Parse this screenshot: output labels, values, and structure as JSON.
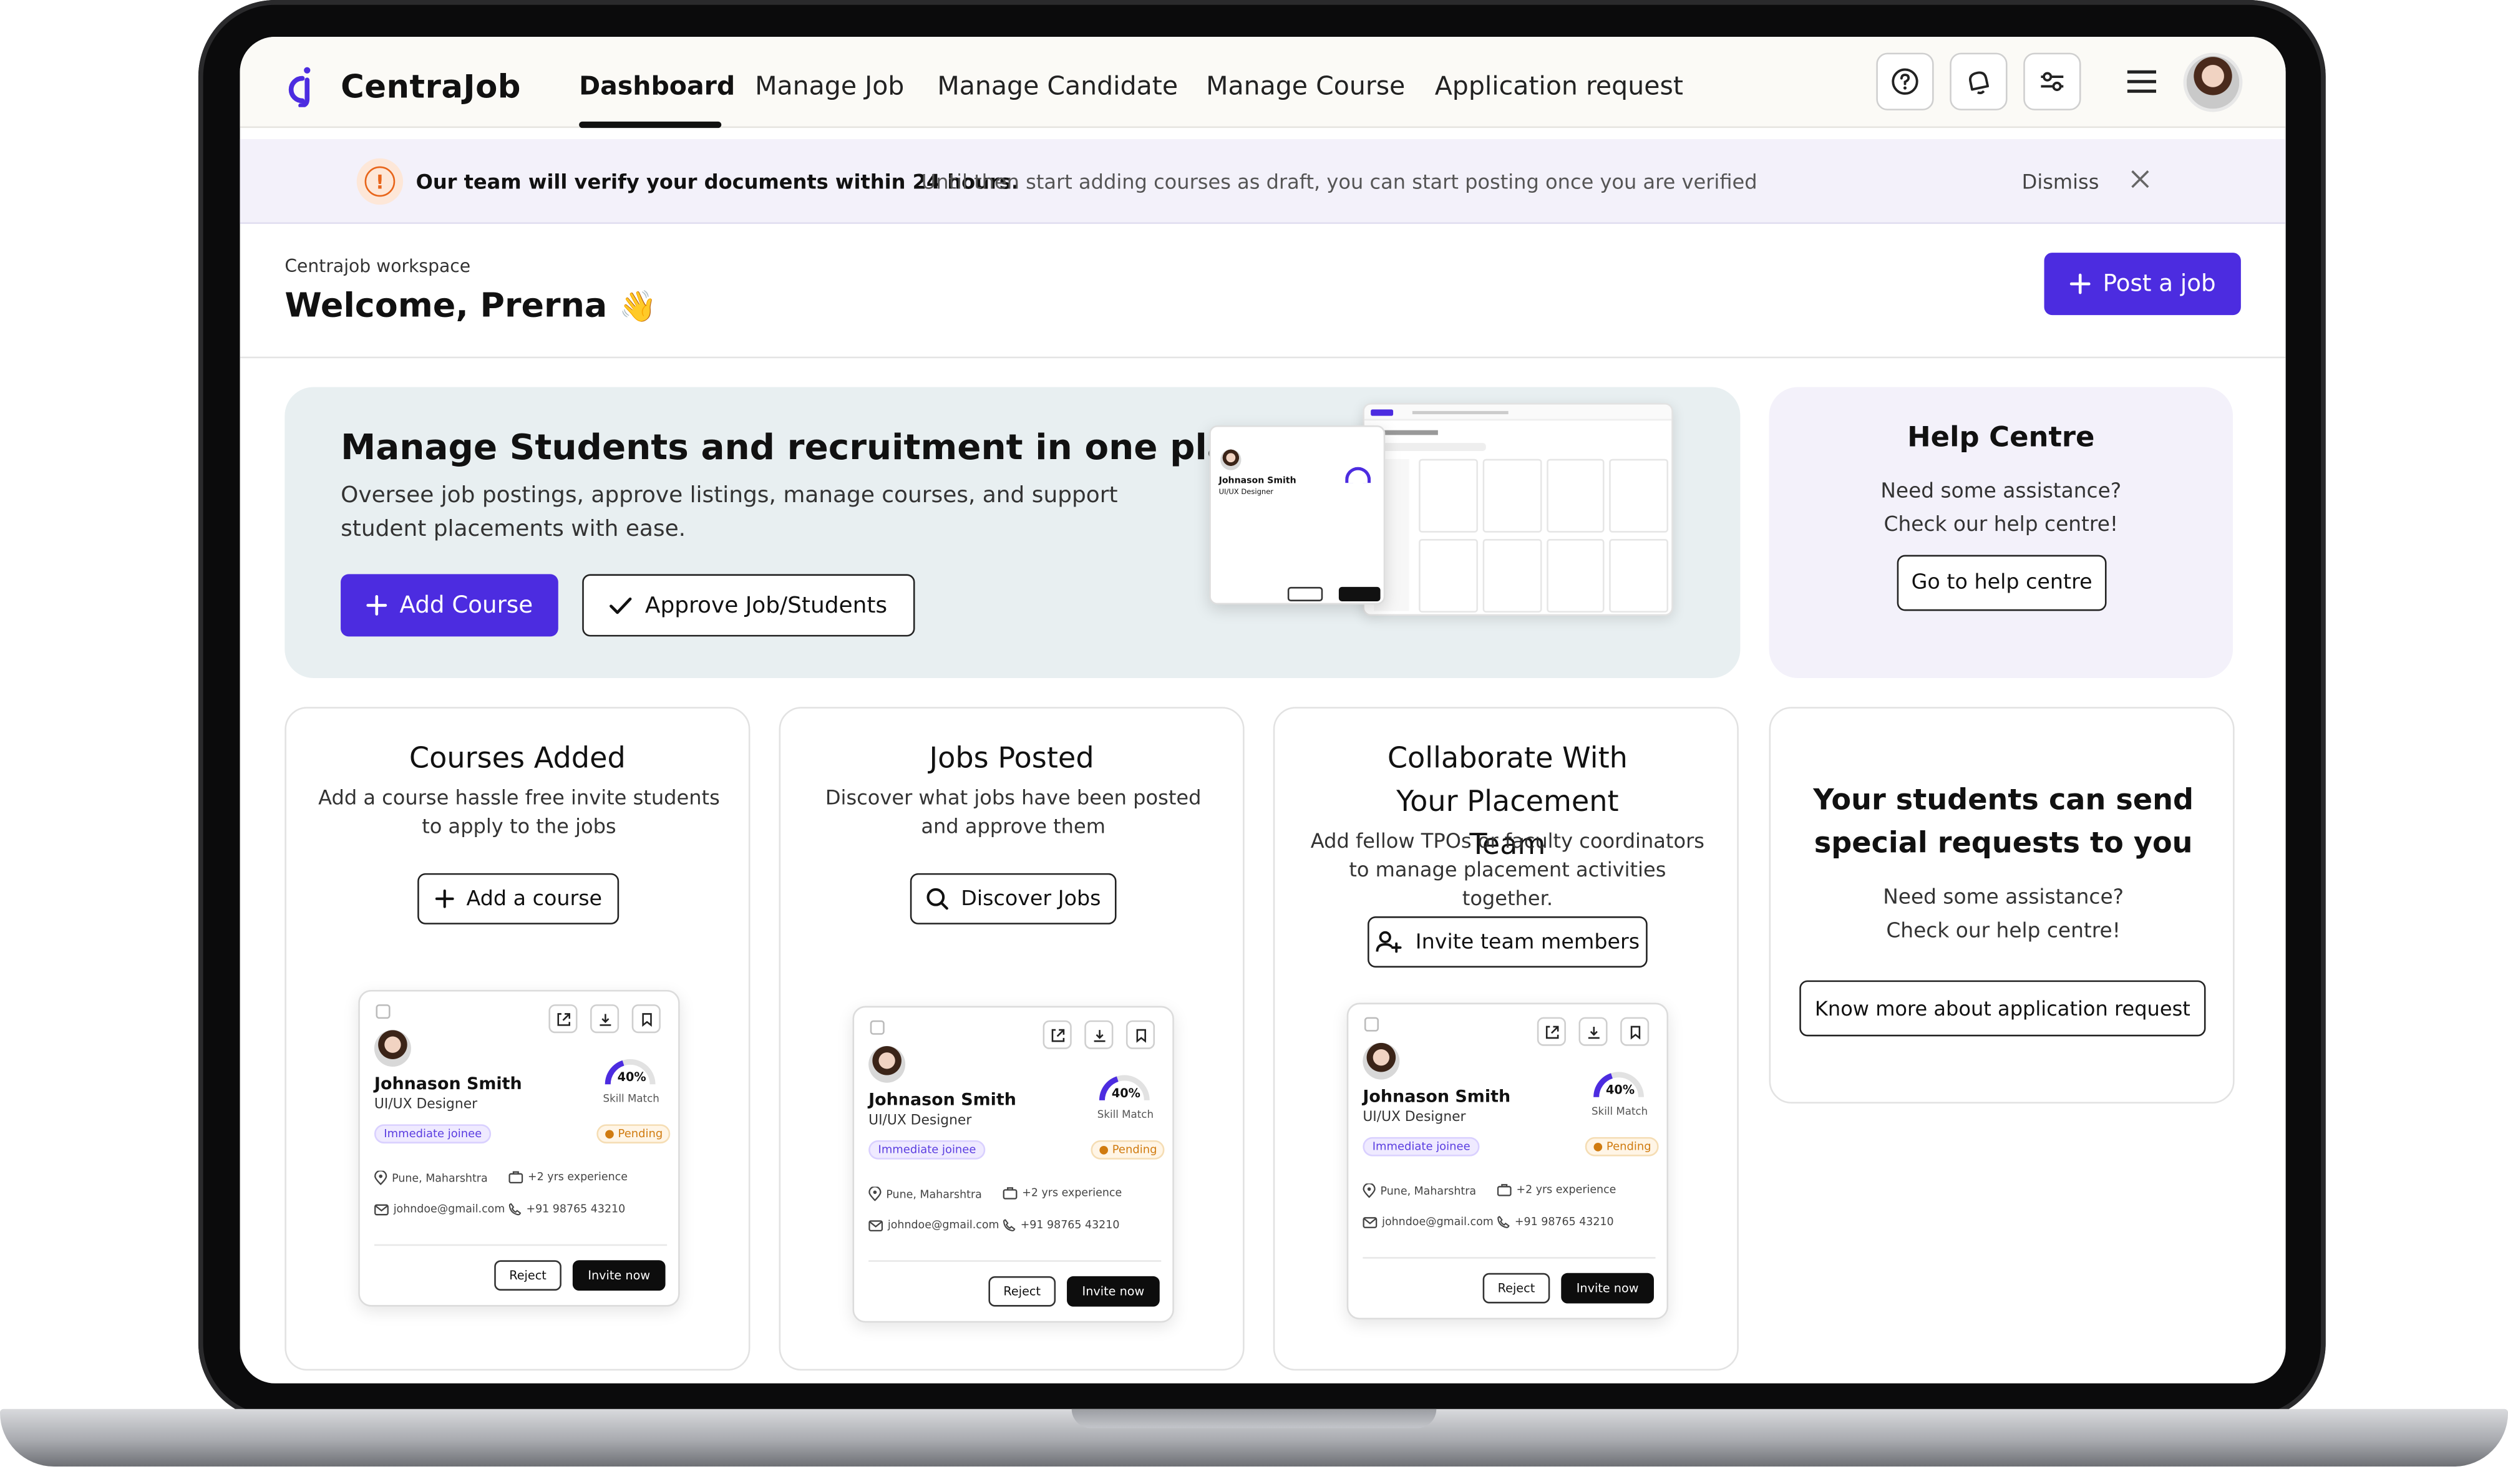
{
  "app": {
    "name": "CentraJob"
  },
  "nav": {
    "links": [
      "Dashboard",
      "Manage Job",
      "Manage Candidate",
      "Manage Course",
      "Application request"
    ],
    "active": "Dashboard",
    "icons": [
      "help-icon",
      "bell-icon",
      "filters-icon",
      "menu-icon"
    ]
  },
  "banner": {
    "strong": "Our team will verify your documents within 24 hours.",
    "text": "Until then start adding courses as draft, you can start posting once you  are verified",
    "dismiss": "Dismiss"
  },
  "header": {
    "workspace": "Centrajob workspace",
    "welcome": "Welcome, Prerna",
    "wave": "👋",
    "post_job": "Post a job"
  },
  "hero": {
    "title": "Manage Students and recruitment in one place",
    "subtitle": "Oversee job postings, approve listings, manage courses, and support student placements with ease.",
    "add_course": "Add Course",
    "approve": "Approve Job/Students"
  },
  "help": {
    "title": "Help Centre",
    "text1": "Need some assistance?",
    "text2": "Check our help centre!",
    "button": "Go to help centre"
  },
  "cards": [
    {
      "title": "Courses Added",
      "text": "Add a course hassle free invite students to apply to the jobs",
      "button": "Add a course",
      "icon": "plus-icon"
    },
    {
      "title": "Jobs Posted",
      "text": "Discover what jobs have been posted and approve them",
      "button": "Discover Jobs",
      "icon": "search-icon"
    },
    {
      "title": "Collaborate With Your Placement Team",
      "text": "Add fellow TPOs or faculty coordinators to manage placement activities together.",
      "button": "Invite team members",
      "icon": "add-user-icon"
    }
  ],
  "request": {
    "title": "Your students can send special requests to you",
    "text1": "Need some assistance?",
    "text2": "Check our help centre!",
    "button": "Know more about application request"
  },
  "candidate": {
    "name": "Johnason Smith",
    "role": "UI/UX Designer",
    "match": "40%",
    "match_value": 40,
    "match_label": "Skill Match",
    "tag": "Immediate joinee",
    "status": "Pending",
    "location": "Pune, Maharshtra",
    "experience": "+2 yrs experience",
    "email": "johndoe@gmail.com",
    "phone": "+91 98765 43210",
    "reject": "Reject",
    "invite": "Invite now"
  },
  "colors": {
    "primary": "#4c2ce0",
    "banner_bg": "#f3f1fa",
    "hero_bg": "#e8eff1",
    "warning": "#e8651a"
  }
}
